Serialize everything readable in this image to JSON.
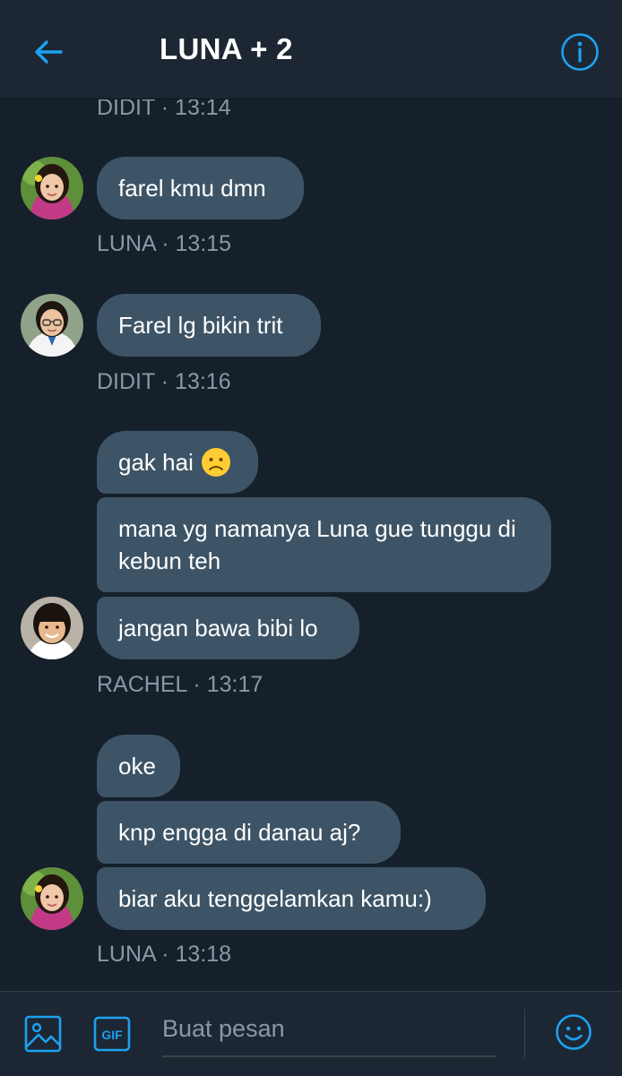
{
  "header": {
    "title": "LUNA + 2",
    "back_icon": "arrow-left-icon",
    "info_icon": "info-icon",
    "accent": "#1da1f2"
  },
  "messages": [
    {
      "id": "m0",
      "sender": "DIDIT",
      "meta": "DIDIT · 13:14"
    },
    {
      "id": "m1",
      "sender": "LUNA",
      "bubbles": [
        "farel kmu dmn"
      ],
      "meta": "LUNA · 13:15"
    },
    {
      "id": "m2",
      "sender": "DIDIT",
      "bubbles": [
        "Farel lg bikin trit"
      ],
      "meta": "DIDIT · 13:16"
    },
    {
      "id": "m3",
      "sender": "RACHEL",
      "bubbles": [
        "gak hai",
        "mana yg namanya Luna gue tunggu di kebun teh",
        "jangan bawa bibi lo"
      ],
      "emoji": "frowning-face-emoji",
      "meta": "RACHEL · 13:17"
    },
    {
      "id": "m4",
      "sender": "LUNA",
      "bubbles": [
        "oke",
        "knp engga di danau aj?",
        "biar aku tenggelamkan kamu:)"
      ],
      "meta": "LUNA · 13:18"
    }
  ],
  "composer": {
    "placeholder": "Buat pesan",
    "image_icon": "image-icon",
    "gif_label": "GIF",
    "emoji_icon": "smiley-icon"
  },
  "colors": {
    "background": "#15202b",
    "bar": "#1c2733",
    "bubble": "#3d5466",
    "meta_text": "#8899a6"
  }
}
